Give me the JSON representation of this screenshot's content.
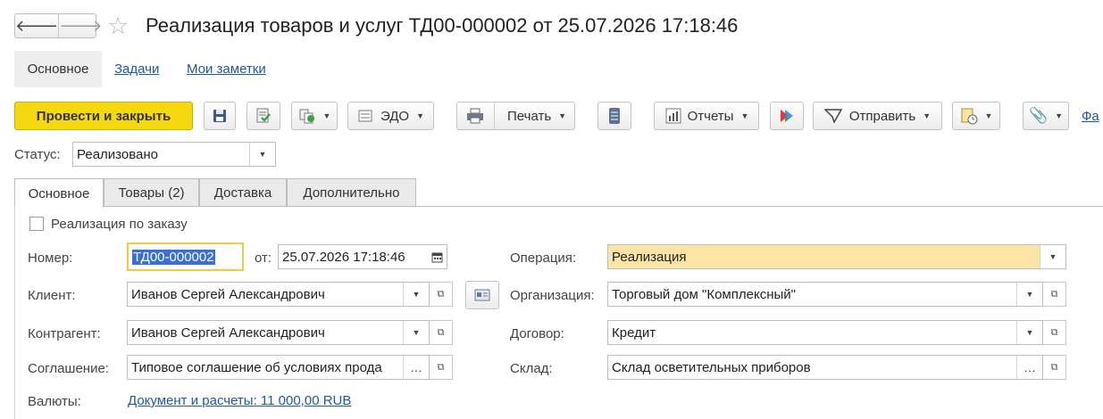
{
  "window": {
    "title": "Реализация товаров и услуг ТД00-000002 от 25.07.2026 17:18:46"
  },
  "nav": {
    "back_icon": "arrow-left-icon",
    "forward_icon": "arrow-right-icon",
    "favorite_icon": "star-icon"
  },
  "page_tabs": {
    "main": "Основное",
    "tasks": "Задачи",
    "notes": "Мои заметки"
  },
  "toolbar": {
    "post_close": "Провести и закрыть",
    "edo": "ЭДО",
    "print": "Печать",
    "reports": "Отчеты",
    "send": "Отправить",
    "files": "Фа"
  },
  "status": {
    "label": "Статус:",
    "value": "Реализовано"
  },
  "form_tabs": [
    "Основное",
    "Товары (2)",
    "Доставка",
    "Дополнительно"
  ],
  "form": {
    "by_order_label": "Реализация по заказу",
    "number_label": "Номер:",
    "number_value": "ТД00-000002",
    "date_label": "от:",
    "date_value": "25.07.2026 17:18:46",
    "client_label": "Клиент:",
    "client_value": "Иванов Сергей Александрович",
    "counterparty_label": "Контрагент:",
    "counterparty_value": "Иванов Сергей Александрович",
    "agreement_label": "Соглашение:",
    "agreement_value": "Типовое соглашение об условиях прода",
    "currency_label": "Валюты:",
    "currency_link": "Документ и расчеты: 11 000,00 RUB",
    "operation_label": "Операция:",
    "operation_value": "Реализация",
    "organization_label": "Организация:",
    "organization_value": "Торговый дом \"Комплексный\"",
    "contract_label": "Договор:",
    "contract_value": "Кредит",
    "warehouse_label": "Склад:",
    "warehouse_value": "Склад осветительных приборов"
  },
  "colors": {
    "primary_button": "#f5d80f",
    "operation_field": "#fbe4a6",
    "link": "#1f58a6",
    "selection": "#3a6fd8"
  }
}
